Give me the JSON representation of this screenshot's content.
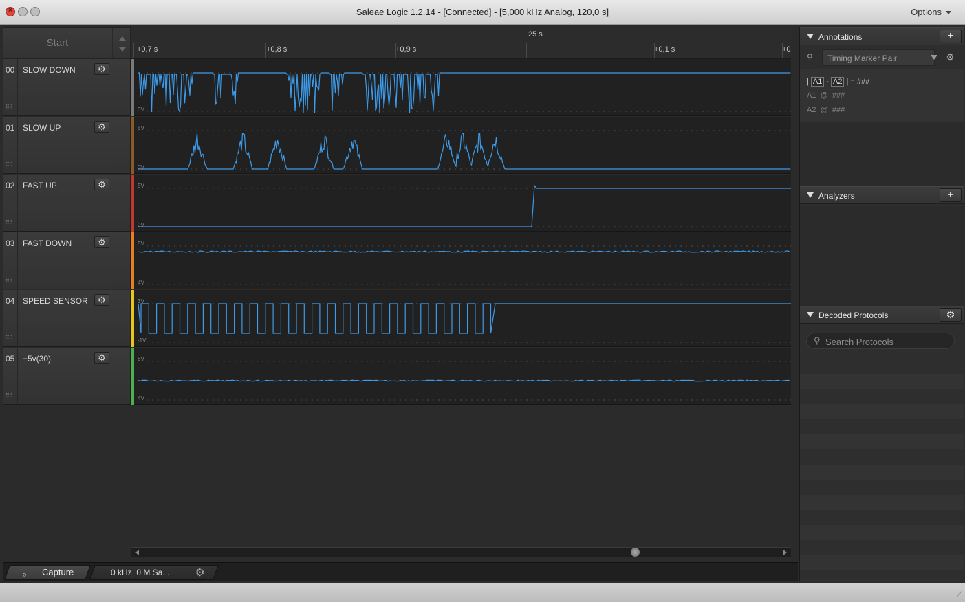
{
  "window": {
    "title": "Saleae Logic 1.2.14 - [Connected] - [5,000 kHz Analog, 120,0 s]",
    "options_label": "Options"
  },
  "start": {
    "label": "Start"
  },
  "timeline": {
    "center_label": "25 s",
    "ticks": [
      "+0,7 s",
      "+0,8 s",
      "+0,9 s",
      "+0,1 s",
      "+0"
    ]
  },
  "channels": [
    {
      "num": "00",
      "name": "SLOW DOWN",
      "color": "#7a7a7a",
      "top_label": "",
      "bottom_label": "0V"
    },
    {
      "num": "01",
      "name": "SLOW UP",
      "color": "#8b5a2b",
      "top_label": "5V",
      "bottom_label": "0V"
    },
    {
      "num": "02",
      "name": "FAST UP",
      "color": "#c0392b",
      "top_label": "5V",
      "bottom_label": "0V"
    },
    {
      "num": "03",
      "name": "FAST DOWN",
      "color": "#e67e22",
      "top_label": "5V",
      "bottom_label": "4V"
    },
    {
      "num": "04",
      "name": "SPEED SENSOR",
      "color": "#e6c619",
      "top_label": "3V",
      "bottom_label": "-1V"
    },
    {
      "num": "05",
      "name": "+5v(30)",
      "color": "#4caf50",
      "top_label": "6V",
      "bottom_label": "4V"
    }
  ],
  "capture": {
    "label": "Capture",
    "rate_text": "0 kHz, 0 M Sa..."
  },
  "annotations": {
    "title": "Annotations",
    "marker_type": "Timing Marker Pair",
    "a1": "A1",
    "a2": "A2",
    "sep": "-",
    "eq": "= ###",
    "at": "@",
    "hash": "###"
  },
  "analyzers": {
    "title": "Analyzers"
  },
  "decoded": {
    "title": "Decoded Protocols",
    "search_placeholder": "Search Protocols"
  },
  "colors": {
    "signal": "#3d9be9",
    "accent": "#e2453c"
  }
}
